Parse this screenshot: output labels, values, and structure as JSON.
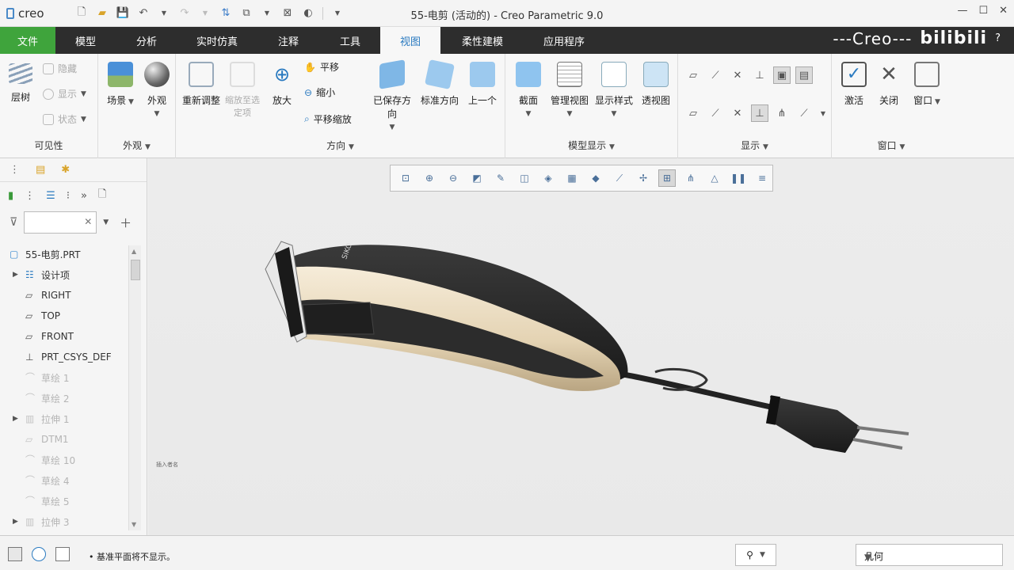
{
  "app": {
    "logo": "creo",
    "title": "55-电剪 (活动的) - Creo Parametric 9.0",
    "window_controls": [
      "—",
      "☐",
      "✕",
      "?"
    ]
  },
  "tabs": [
    {
      "label": "文件"
    },
    {
      "label": "模型"
    },
    {
      "label": "分析"
    },
    {
      "label": "实时仿真"
    },
    {
      "label": "注释"
    },
    {
      "label": "工具"
    },
    {
      "label": "视图"
    },
    {
      "label": "柔性建模"
    },
    {
      "label": "应用程序"
    }
  ],
  "watermark": {
    "text": "---Creo---",
    "brand": "bilibili"
  },
  "ribbon": {
    "visibility": {
      "title": "可见性",
      "layer_tree": "层树",
      "hide": "隐藏",
      "show": "显示",
      "status": "状态"
    },
    "appearance": {
      "title": "外观",
      "scene": "场景",
      "appearance": "外观"
    },
    "orientation": {
      "title": "方向",
      "refit": "重新调整",
      "zoom_selected": "缩放至选定项",
      "zoom_in": "放大",
      "pan": "平移",
      "zoom_out": "缩小",
      "pan_zoom": "平移缩放",
      "saved": "已保存方向",
      "standard": "标准方向",
      "previous": "上一个"
    },
    "model_display": {
      "title": "模型显示",
      "section": "截面",
      "manage_views": "管理视图",
      "display_style": "显示样式",
      "perspective": "透视图"
    },
    "show": {
      "title": "显示"
    },
    "window": {
      "title": "窗口",
      "activate": "激活",
      "close": "关闭",
      "windows": "窗口"
    }
  },
  "left_panel": {
    "filter_placeholder": "",
    "tree": [
      {
        "label": "55-电剪.PRT",
        "icon": "part-icon",
        "dim": false,
        "expand": false,
        "root": true
      },
      {
        "label": "设计项",
        "icon": "design-items-icon",
        "dim": false,
        "expand": true
      },
      {
        "label": "RIGHT",
        "icon": "datum-plane-icon",
        "dim": false,
        "expand": false
      },
      {
        "label": "TOP",
        "icon": "datum-plane-icon",
        "dim": false,
        "expand": false
      },
      {
        "label": "FRONT",
        "icon": "datum-plane-icon",
        "dim": false,
        "expand": false
      },
      {
        "label": "PRT_CSYS_DEF",
        "icon": "csys-icon",
        "dim": false,
        "expand": false
      },
      {
        "label": "草绘 1",
        "icon": "sketch-icon",
        "dim": true,
        "expand": false
      },
      {
        "label": "草绘 2",
        "icon": "sketch-icon",
        "dim": true,
        "expand": false
      },
      {
        "label": "拉伸 1",
        "icon": "extrude-icon",
        "dim": true,
        "expand": true
      },
      {
        "label": "DTM1",
        "icon": "datum-plane-icon",
        "dim": true,
        "expand": false
      },
      {
        "label": "草绘 10",
        "icon": "sketch-icon",
        "dim": true,
        "expand": false
      },
      {
        "label": "草绘 4",
        "icon": "sketch-icon",
        "dim": true,
        "expand": false
      },
      {
        "label": "草绘 5",
        "icon": "sketch-icon",
        "dim": true,
        "expand": false
      },
      {
        "label": "拉伸 3",
        "icon": "extrude-icon",
        "dim": true,
        "expand": true
      }
    ]
  },
  "viewport": {
    "model_label": "SIKO",
    "corner_text": "插入者名"
  },
  "status_bar": {
    "message": "• 基准平面将不显示。",
    "selection_filter": "几何"
  },
  "colors": {
    "file_tab": "#3fa43c",
    "tab_bar": "#2d2d2d",
    "active_tab_text": "#2a7ac0"
  }
}
